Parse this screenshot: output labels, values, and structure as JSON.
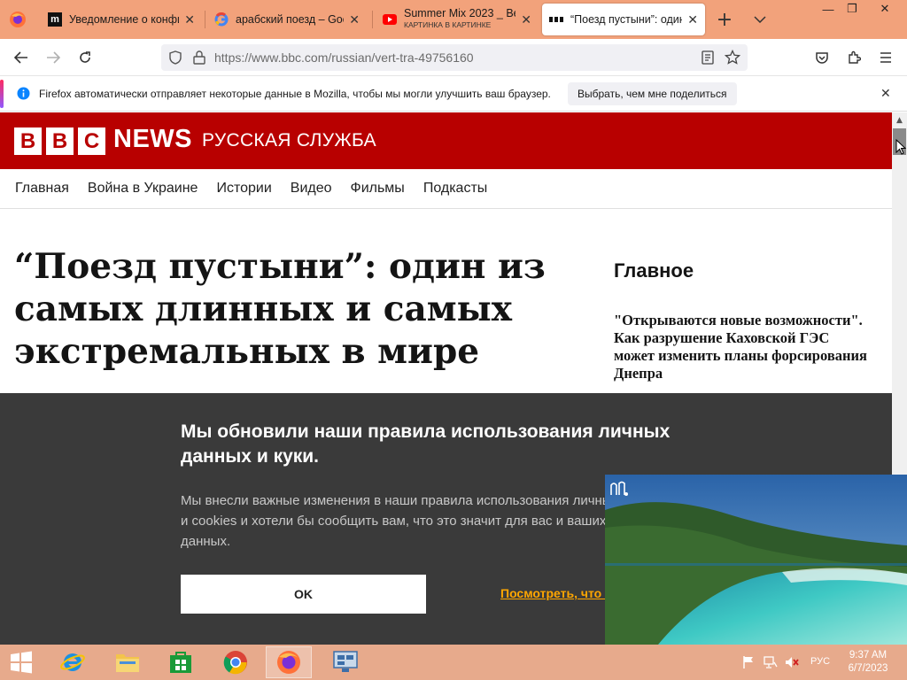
{
  "browser": {
    "tabs": [
      {
        "title": "Уведомление о конфид",
        "icon": "m-icon"
      },
      {
        "title": "арабский поезд – Googl",
        "icon": "google-icon"
      },
      {
        "title": "Summer Mix 2023 _ Bes",
        "subtitle": "КАРТИНКА В КАРТИНКЕ",
        "icon": "youtube-icon"
      },
      {
        "title": "“Поезд пустыни”: один",
        "icon": "bbc-icon",
        "active": true
      }
    ],
    "url": "https://www.bbc.com/russian/vert-tra-49756160",
    "notification": {
      "text": "Firefox автоматически отправляет некоторые данные в Mozilla, чтобы мы могли улучшить ваш браузер.",
      "button": "Выбрать, чем мне поделиться"
    }
  },
  "page": {
    "header": {
      "blocks": [
        "B",
        "B",
        "C"
      ],
      "news": "NEWS",
      "service": "РУССКАЯ СЛУЖБА"
    },
    "nav": [
      "Главная",
      "Война в Украине",
      "Истории",
      "Видео",
      "Фильмы",
      "Подкасты"
    ],
    "headline": "“Поезд пустыни”: один из самых длинных и самых экстремальных в мире",
    "sidebar": {
      "title": "Главное",
      "story": "\"Открываются новые возможности\". Как разрушение Каховской ГЭС может изменить планы форсирования Днепра"
    },
    "cookie": {
      "title": "Мы обновили наши правила использования личных данных и куки.",
      "text": "Мы внесли важные изменения в наши правила использования личных данных и cookies и хотели бы сообщить вам, что это значит для вас и ваших личных данных.",
      "ok": "OK",
      "link": "Посмотреть, что изменилось"
    }
  },
  "taskbar": {
    "language": "РУС",
    "time": "9:37 AM",
    "date": "6/7/2023"
  }
}
